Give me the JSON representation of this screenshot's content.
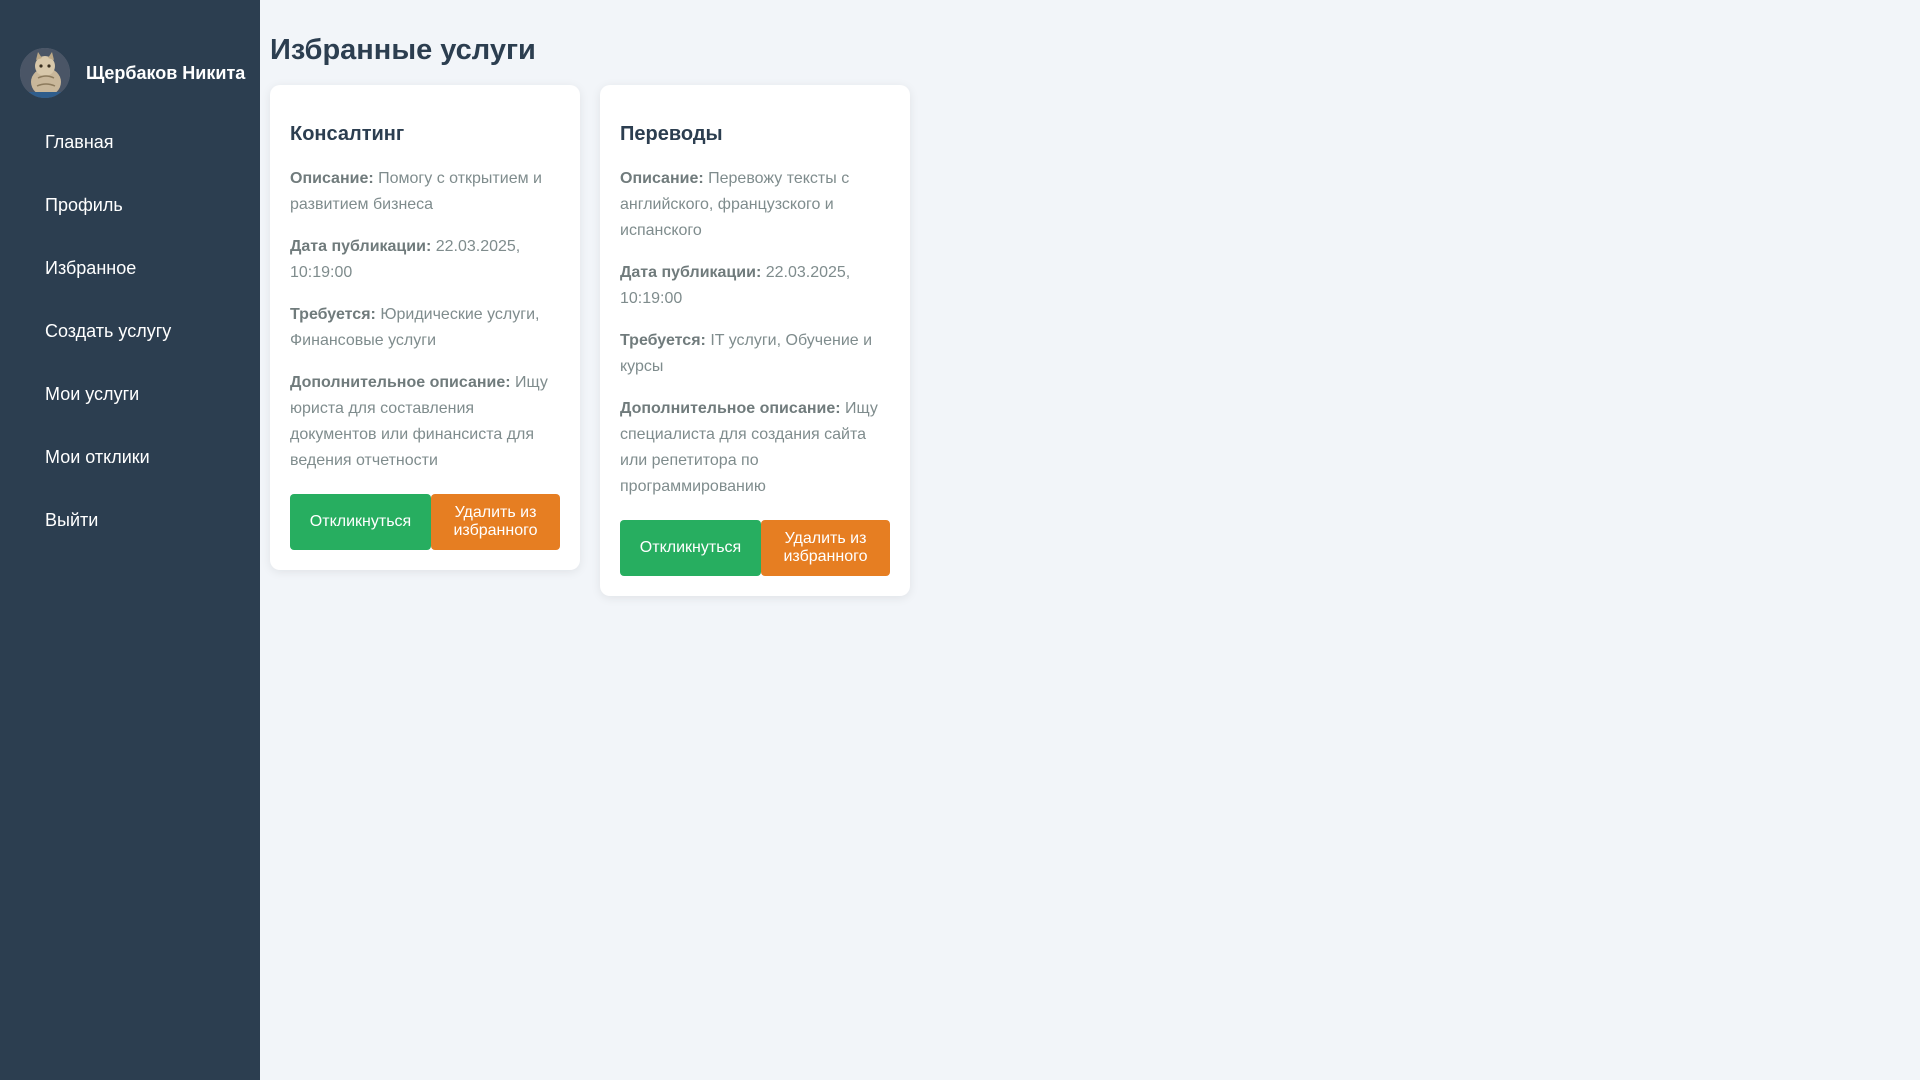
{
  "sidebar": {
    "user_name": "Щербаков Никита",
    "nav": [
      {
        "label": "Главная"
      },
      {
        "label": "Профиль"
      },
      {
        "label": "Избранное"
      },
      {
        "label": "Создать услугу"
      },
      {
        "label": "Мои услуги"
      },
      {
        "label": "Мои отклики"
      },
      {
        "label": "Выйти"
      }
    ]
  },
  "main": {
    "title": "Избранные услуги",
    "labels": {
      "description": "Описание:",
      "published": "Дата публикации:",
      "required": "Требуется:",
      "extra": "Дополнительное описание:"
    },
    "cards": [
      {
        "title": "Консалтинг",
        "description": "Помогу с открытием и развитием бизнеса",
        "published": "22.03.2025, 10:19:00",
        "required": "Юридические услуги, Финансовые услуги",
        "extra": "Ищу юриста для составления документов или финансиста для ведения отчетности",
        "respond_label": "Откликнуться",
        "remove_label": "Удалить из избранного"
      },
      {
        "title": "Переводы",
        "description": "Перевожу тексты с английского, французского и испанского",
        "published": "22.03.2025, 10:19:00",
        "required": "IT услуги, Обучение и курсы",
        "extra": "Ищу специалиста для создания сайта или репетитора по программированию",
        "respond_label": "Откликнуться",
        "remove_label": "Удалить из избранного"
      }
    ]
  },
  "colors": {
    "sidebar_bg": "#2c3e50",
    "page_bg": "#f2f5f9",
    "respond_button": "#27ae60",
    "remove_button": "#e67e22",
    "heading": "#2c3e50",
    "text_muted": "#7f8c8d"
  },
  "icons": {
    "avatar": "cat-photo-avatar"
  }
}
